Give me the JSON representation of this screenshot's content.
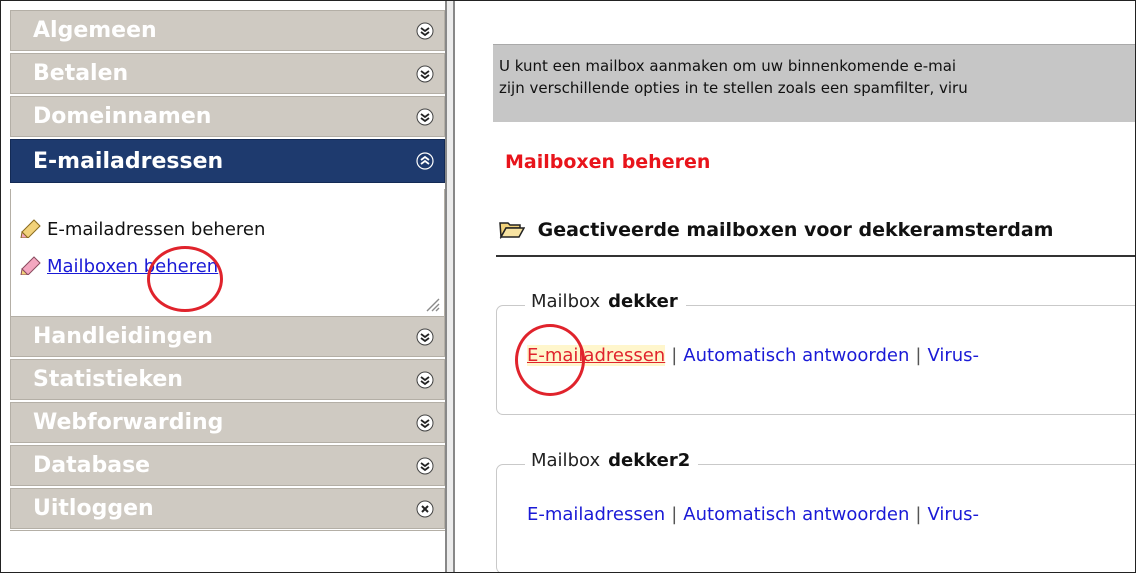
{
  "sidebar": {
    "headers": [
      {
        "label": "Algemeen",
        "icon": "chevron-down-icon",
        "active": false
      },
      {
        "label": "Betalen",
        "icon": "chevron-down-icon",
        "active": false
      },
      {
        "label": "Domeinnamen",
        "icon": "chevron-down-icon",
        "active": false
      },
      {
        "label": "E-mailadressen",
        "icon": "chevron-up-icon",
        "active": true
      },
      {
        "label": "Handleidingen",
        "icon": "chevron-down-icon",
        "active": false
      },
      {
        "label": "Statistieken",
        "icon": "chevron-down-icon",
        "active": false
      },
      {
        "label": "Webforwarding",
        "icon": "chevron-down-icon",
        "active": false
      },
      {
        "label": "Database",
        "icon": "chevron-down-icon",
        "active": false
      },
      {
        "label": "Uitloggen",
        "icon": "close-icon",
        "active": false
      }
    ],
    "panel_links": [
      {
        "label": "E-mailadressen beheren",
        "is_link": false
      },
      {
        "label": "Mailboxen beheren",
        "is_link": true
      }
    ]
  },
  "main": {
    "info_lines": [
      "U kunt een mailbox aanmaken om uw binnenkomende e-mai",
      "zijn verschillende opties in te stellen zoals een spamfilter, viru"
    ],
    "section_title": "Mailboxen beheren",
    "activated_title": "Geactiveerde mailboxen voor dekkeramsterdam",
    "mailboxes": [
      {
        "prefix": "Mailbox",
        "name": "dekker",
        "links": [
          "E-mailadressen",
          "Automatisch antwoorden",
          "Virus-"
        ],
        "highlight_first": true
      },
      {
        "prefix": "Mailbox",
        "name": "dekker2",
        "links": [
          "E-mailadressen",
          "Automatisch antwoorden",
          "Virus-"
        ],
        "highlight_first": false
      }
    ]
  },
  "colors": {
    "header_inactive": "#cfcac2",
    "header_active": "#1e3a6e",
    "section_title": "#e8141b",
    "link": "#1a1ad6",
    "annotation_circle": "#e0232c"
  }
}
